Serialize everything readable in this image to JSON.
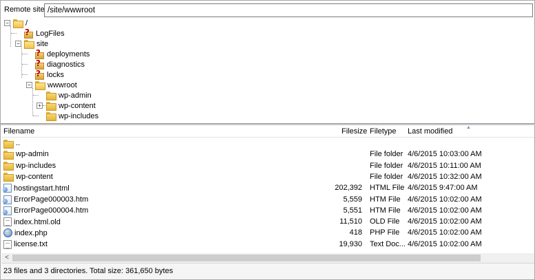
{
  "remote": {
    "label": "Remote site:",
    "path": "/site/wwwroot"
  },
  "tree": {
    "root": "/",
    "logfiles": "LogFiles",
    "site": "site",
    "deployments": "deployments",
    "diagnostics": "diagnostics",
    "locks": "locks",
    "wwwroot": "wwwroot",
    "wp_admin": "wp-admin",
    "wp_content": "wp-content",
    "wp_includes": "wp-includes"
  },
  "list": {
    "headers": {
      "filename": "Filename",
      "filesize": "Filesize",
      "filetype": "Filetype",
      "modified": "Last modified"
    },
    "sort_icon": "sort-ascending-icon",
    "rows": [
      {
        "icon": "folder-icon",
        "name": "..",
        "size": "",
        "type": "",
        "modified": ""
      },
      {
        "icon": "folder-icon",
        "name": "wp-admin",
        "size": "",
        "type": "File folder",
        "modified": "4/6/2015 10:03:00 AM"
      },
      {
        "icon": "folder-icon",
        "name": "wp-includes",
        "size": "",
        "type": "File folder",
        "modified": "4/6/2015 10:11:00 AM"
      },
      {
        "icon": "folder-icon",
        "name": "wp-content",
        "size": "",
        "type": "File folder",
        "modified": "4/6/2015 10:32:00 AM"
      },
      {
        "icon": "html-file-icon",
        "name": "hostingstart.html",
        "size": "202,392",
        "type": "HTML File",
        "modified": "4/6/2015 9:47:00 AM"
      },
      {
        "icon": "html-file-icon",
        "name": "ErrorPage000003.htm",
        "size": "5,559",
        "type": "HTM File",
        "modified": "4/6/2015 10:02:00 AM"
      },
      {
        "icon": "html-file-icon",
        "name": "ErrorPage000004.htm",
        "size": "5,551",
        "type": "HTM File",
        "modified": "4/6/2015 10:02:00 AM"
      },
      {
        "icon": "file-icon",
        "name": "index.html.old",
        "size": "11,510",
        "type": "OLD File",
        "modified": "4/6/2015 10:02:00 AM"
      },
      {
        "icon": "php-file-icon",
        "name": "index.php",
        "size": "418",
        "type": "PHP File",
        "modified": "4/6/2015 10:02:00 AM"
      },
      {
        "icon": "file-icon",
        "name": "license.txt",
        "size": "19,930",
        "type": "Text Doc...",
        "modified": "4/6/2015 10:02:00 AM"
      }
    ]
  },
  "scrollbar": {
    "left_arrow": "<"
  },
  "status": {
    "text": "23 files and 3 directories. Total size: 361,650 bytes"
  }
}
